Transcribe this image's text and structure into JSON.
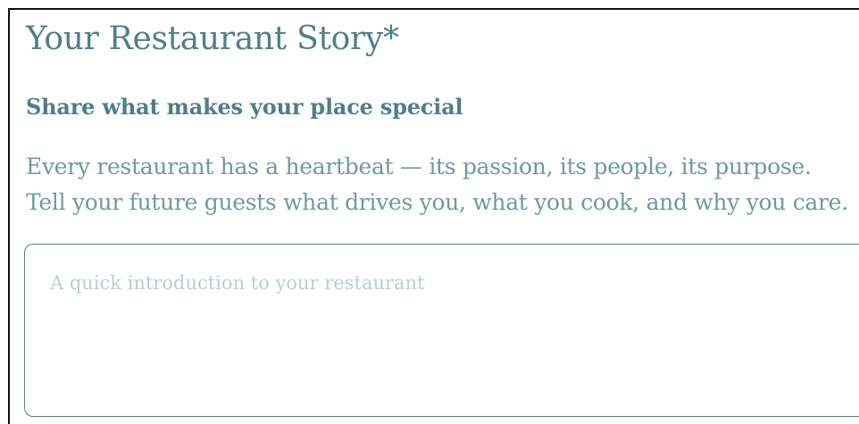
{
  "form": {
    "title": "Your Restaurant Story*",
    "subtitle": "Share what makes your place special",
    "description_lines": [
      "Every restaurant has a heartbeat — its passion, its people, its purpose.",
      "Tell your future guests what drives you, what you cook, and why you care."
    ],
    "intro_field": {
      "value": "",
      "placeholder": "A quick introduction to your restaurant"
    }
  },
  "colors": {
    "accent": "#4e7f88",
    "body_text": "#6e9aa1",
    "placeholder": "#b8cfd3",
    "frame_border": "#111111"
  }
}
